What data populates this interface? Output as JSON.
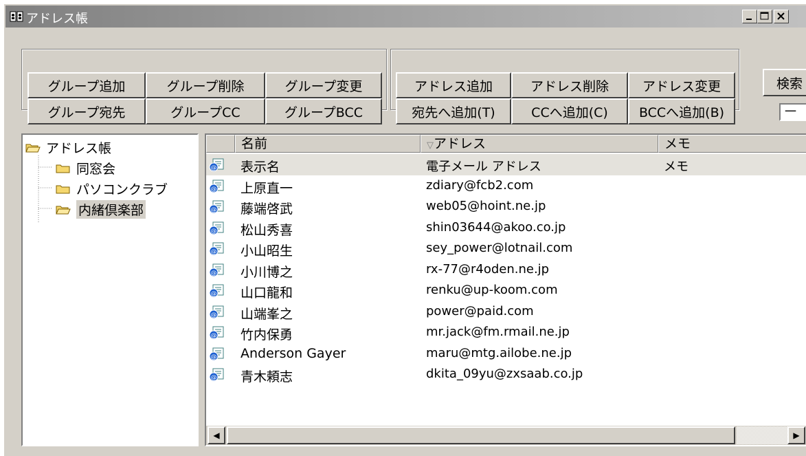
{
  "window": {
    "title": "アドレス帳"
  },
  "group_buttons": {
    "add": "グループ追加",
    "delete": "グループ削除",
    "change": "グループ変更",
    "to": "グループ宛先",
    "cc": "グループCC",
    "bcc": "グループBCC"
  },
  "address_buttons": {
    "add": "アドレス追加",
    "delete": "アドレス削除",
    "change": "アドレス変更",
    "to": "宛先へ追加(T)",
    "cc": "CCへ追加(C)",
    "bcc": "BCCへ追加(B)"
  },
  "search": {
    "button": "検索",
    "field_value": "一"
  },
  "tree": {
    "root": "アドレス帳",
    "children": [
      "同窓会",
      "パソコンクラブ",
      "内緒倶楽部"
    ],
    "selected_index": 2
  },
  "list": {
    "columns": {
      "name": "名前",
      "address": "アドレス",
      "memo": "メモ"
    },
    "sort_indicator": "▽",
    "rows": [
      {
        "name": "表示名",
        "address": "電子メール アドレス",
        "memo": "メモ"
      },
      {
        "name": "上原直一",
        "address": "zdiary@fcb2.com",
        "memo": ""
      },
      {
        "name": "藤端啓武",
        "address": "web05@hoint.ne.jp",
        "memo": ""
      },
      {
        "name": "松山秀喜",
        "address": "shin03644@akoo.co.jp",
        "memo": ""
      },
      {
        "name": "小山昭生",
        "address": "sey_power@lotnail.com",
        "memo": ""
      },
      {
        "name": "小川博之",
        "address": "rx-77@r4oden.ne.jp",
        "memo": ""
      },
      {
        "name": "山口龍和",
        "address": "renku@up-koom.com",
        "memo": ""
      },
      {
        "name": "山端峯之",
        "address": "power@paid.com",
        "memo": ""
      },
      {
        "name": "竹内保勇",
        "address": "mr.jack@fm.rmail.ne.jp",
        "memo": ""
      },
      {
        "name": "Anderson Gayer",
        "address": "maru@mtg.ailobe.ne.jp",
        "memo": ""
      },
      {
        "name": "青木頼志",
        "address": "dkita_09yu@zxsaab.co.jp",
        "memo": ""
      }
    ]
  },
  "colors": {
    "face": "#d4d0c8",
    "title_gradient_start": "#808080",
    "folder": "#f5d76e"
  }
}
